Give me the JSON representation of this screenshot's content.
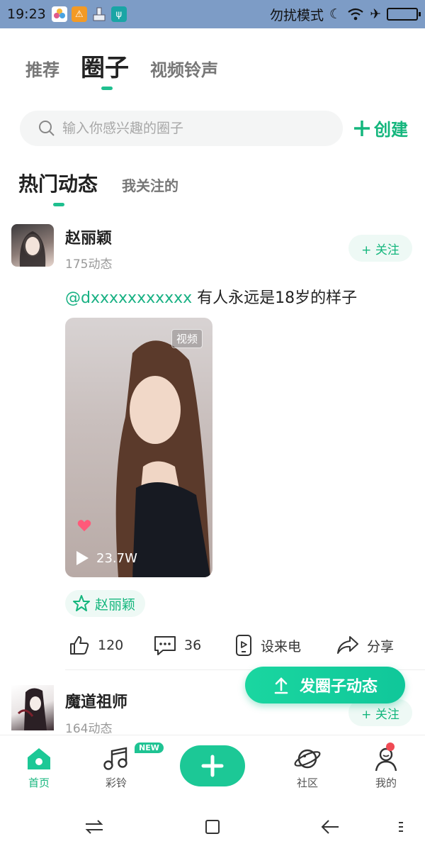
{
  "status_bar": {
    "time": "19:23",
    "mode_text": "勿扰模式"
  },
  "top_tabs": [
    {
      "label": "推荐",
      "active": false
    },
    {
      "label": "圈子",
      "active": true
    },
    {
      "label": "视频铃声",
      "active": false
    }
  ],
  "search": {
    "placeholder": "输入你感兴趣的圈子",
    "create_label": "创建"
  },
  "sub_tabs": [
    {
      "label": "热门动态",
      "active": true
    },
    {
      "label": "我关注的",
      "active": false
    }
  ],
  "posts": [
    {
      "author": "赵丽颖",
      "meta": "175动态",
      "follow_label": "+ 关注",
      "mention": "@dxxxxxxxxxxx",
      "text": " 有人永远是18岁的样子",
      "video_badge": "视频",
      "plays": "23.7W",
      "topic": "赵丽颖",
      "likes": "120",
      "comments": "36",
      "ringtone_label": "设来电",
      "share_label": "分享"
    },
    {
      "author": "魔道祖师",
      "meta": "164动态",
      "follow_label": "+ 关注"
    }
  ],
  "fab": {
    "label": "发圈子动态"
  },
  "bottom_nav": [
    {
      "label": "首页",
      "icon": "home-icon",
      "active": true
    },
    {
      "label": "彩铃",
      "icon": "music-note-icon",
      "active": false,
      "badge": "NEW"
    },
    {
      "label": "",
      "icon": "plus-icon"
    },
    {
      "label": "社区",
      "icon": "planet-icon",
      "active": false
    },
    {
      "label": "我的",
      "icon": "user-icon",
      "active": false,
      "dot": true
    }
  ],
  "colors": {
    "accent": "#14b67d",
    "status_bar": "#7d9cc6",
    "badge_red": "#f04a54"
  }
}
